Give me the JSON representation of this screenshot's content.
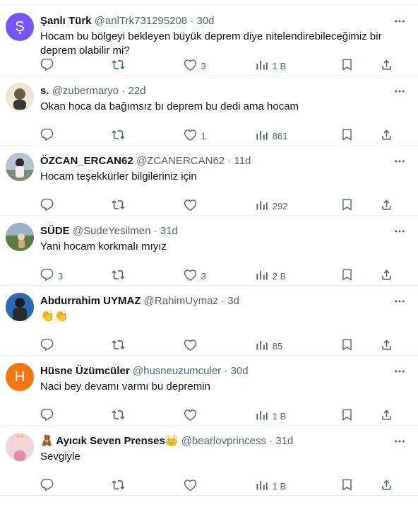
{
  "tweets": [
    {
      "name": "Şanlı Türk",
      "handle": "@anlTrk731295208",
      "time": "30d",
      "text": "Hocam bu bölgeyi bekleyen büyük deprem diye nitelendirebileceğimiz bir deprem olabilir mi?",
      "replies": "",
      "likes": "3",
      "views": "1 B",
      "avatar_letter": "Ş",
      "avatar_color": "#7856ff"
    },
    {
      "name": "s.",
      "handle": "@zubermaryo",
      "time": "22d",
      "text": "Okan hoca da bağımsız bı deprem bu dedi ama hocam",
      "replies": "",
      "likes": "1",
      "views": "861"
    },
    {
      "name": "ÖZCAN_ERCAN62",
      "handle": "@ZCANERCAN62",
      "time": "11d",
      "text": "Hocam teşekkürler bilgileriniz için",
      "replies": "",
      "likes": "",
      "views": "292"
    },
    {
      "name": "SÜDE",
      "handle": "@SudeYesilmen",
      "time": "31d",
      "text": "Yani hocam korkmalı mıyız",
      "replies": "3",
      "likes": "3",
      "views": "2 B"
    },
    {
      "name": "Abdurrahim UYMAZ",
      "handle": "@RahimUymaz",
      "time": "3d",
      "text": "👏👏",
      "replies": "",
      "likes": "",
      "views": "85"
    },
    {
      "name": "Hüsne Üzümcüler",
      "handle": "@husneuzumculer",
      "time": "30d",
      "text": "Naci bey devamı varmı bu depremin",
      "replies": "",
      "likes": "",
      "views": "1 B",
      "avatar_letter": "H",
      "avatar_color": "#f4760f"
    },
    {
      "name": "🧸 Ayıcık Seven Prenses👑",
      "handle": "@bearlovprincess",
      "time": "31d",
      "text": "Sevgiyle",
      "replies": "",
      "likes": "",
      "views": "1 B"
    }
  ],
  "colors": {
    "text_secondary": "#536471",
    "border": "#eff3f4"
  },
  "icons": [
    "reply-icon",
    "retweet-icon",
    "like-icon",
    "views-icon",
    "bookmark-icon",
    "share-icon",
    "more-icon"
  ]
}
